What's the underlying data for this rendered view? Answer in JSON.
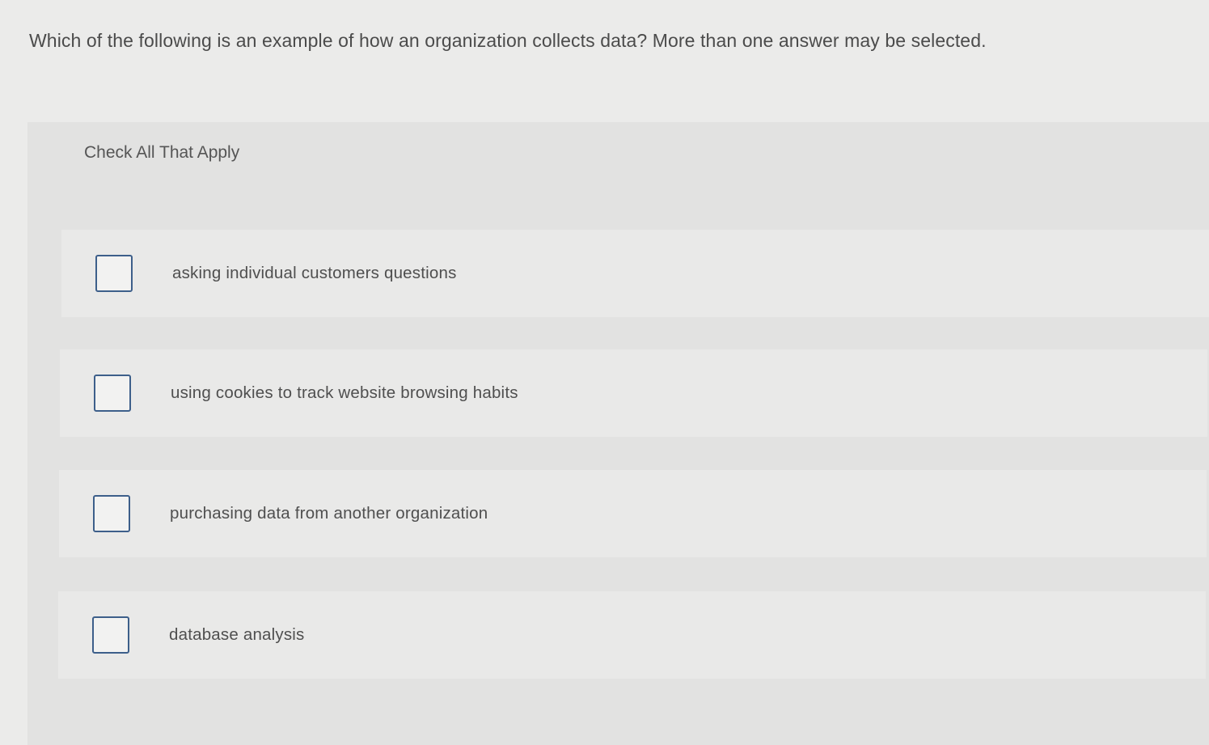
{
  "question": {
    "text": "Which of the following is an example of how an organization collects data? More than one answer may be selected."
  },
  "panel": {
    "label": "Check All That Apply",
    "options": [
      {
        "label": "asking individual customers questions",
        "checked": false
      },
      {
        "label": "using cookies to track website browsing habits",
        "checked": false
      },
      {
        "label": "purchasing data from another organization",
        "checked": false
      },
      {
        "label": "database analysis",
        "checked": false
      }
    ]
  },
  "colors": {
    "background": "#ebebea",
    "panel": "#e2e2e1",
    "option": "#e9e9e8",
    "checkbox_border": "#3d5f8a",
    "text": "#4b4b4b"
  }
}
